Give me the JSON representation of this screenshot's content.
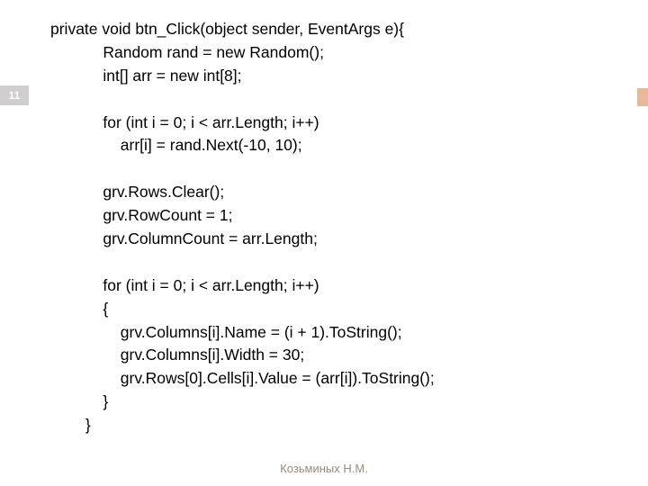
{
  "page_number": "11",
  "code": {
    "line1": "private void btn_Click(object sender, EventArgs e){",
    "line2": "            Random rand = new Random();",
    "line3": "            int[] arr = new int[8];",
    "line4": "",
    "line5": "            for (int i = 0; i < arr.Length; i++)",
    "line6": "                arr[i] = rand.Next(-10, 10);",
    "line7": "",
    "line8": "            grv.Rows.Clear();",
    "line9": "            grv.RowCount = 1;",
    "line10": "            grv.ColumnCount = arr.Length;",
    "line11": "",
    "line12": "            for (int i = 0; i < arr.Length; i++)",
    "line13": "            {",
    "line14": "                grv.Columns[i].Name = (i + 1).ToString();",
    "line15": "                grv.Columns[i].Width = 30;",
    "line16": "                grv.Rows[0].Cells[i].Value = (arr[i]).ToString();",
    "line17": "            }",
    "line18": "        }"
  },
  "footer": "Козьминых Н.М."
}
